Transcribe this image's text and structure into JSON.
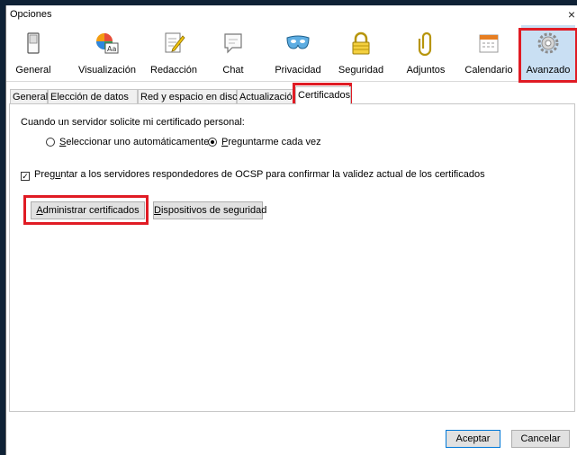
{
  "window": {
    "title": "Opciones",
    "close_glyph": "×"
  },
  "toolbar": {
    "items": [
      {
        "label": "General",
        "icon": "switch-icon"
      },
      {
        "label": "Visualización",
        "icon": "display-icon"
      },
      {
        "label": "Redacción",
        "icon": "compose-icon"
      },
      {
        "label": "Chat",
        "icon": "chat-icon"
      },
      {
        "label": "Privacidad",
        "icon": "mask-icon"
      },
      {
        "label": "Seguridad",
        "icon": "lock-icon"
      },
      {
        "label": "Adjuntos",
        "icon": "paperclip-icon"
      },
      {
        "label": "Calendario",
        "icon": "calendar-icon"
      },
      {
        "label": "Avanzado",
        "icon": "gear-icon",
        "selected": true
      }
    ]
  },
  "subtabs": {
    "items": [
      "General",
      "Elección de datos",
      "Red y espacio en disco",
      "Actualización",
      "Certificados"
    ],
    "active": "Certificados"
  },
  "certificates": {
    "prompt": "Cuando un servidor solicite mi certificado personal:",
    "radio_auto": {
      "u": "S",
      "rest": "eleccionar uno automáticamente",
      "selected": false
    },
    "radio_ask": {
      "u": "P",
      "rest": "reguntarme cada vez",
      "selected": true
    },
    "ocsp": {
      "pre": "Preg",
      "u": "u",
      "rest": "ntar a los servidores respondedores de OCSP para confirmar la validez actual de los certificados",
      "checked": true
    },
    "manage_button": {
      "u": "A",
      "rest": "dministrar certificados"
    },
    "devices_button": {
      "u": "D",
      "rest": "ispositivos de seguridad"
    }
  },
  "footer": {
    "accept": "Aceptar",
    "cancel": "Cancelar"
  },
  "colors": {
    "highlight": "#e01b24",
    "selected_bg": "#c9dff3",
    "default_border": "#0078d7"
  }
}
